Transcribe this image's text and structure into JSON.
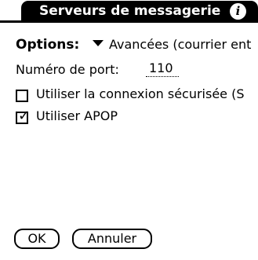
{
  "header": {
    "title": "Serveurs de messagerie",
    "info_icon": "info-icon"
  },
  "options": {
    "label": "Options:",
    "selected": "Avancées (courrier ent",
    "dropdown_icon": "triangle-down-icon"
  },
  "port": {
    "label": "Numéro de port:",
    "value": "110"
  },
  "checkboxes": [
    {
      "label": "Utiliser la connexion sécurisée (S",
      "checked": false
    },
    {
      "label": "Utiliser APOP",
      "checked": true
    }
  ],
  "buttons": {
    "ok": "OK",
    "cancel": "Annuler"
  }
}
